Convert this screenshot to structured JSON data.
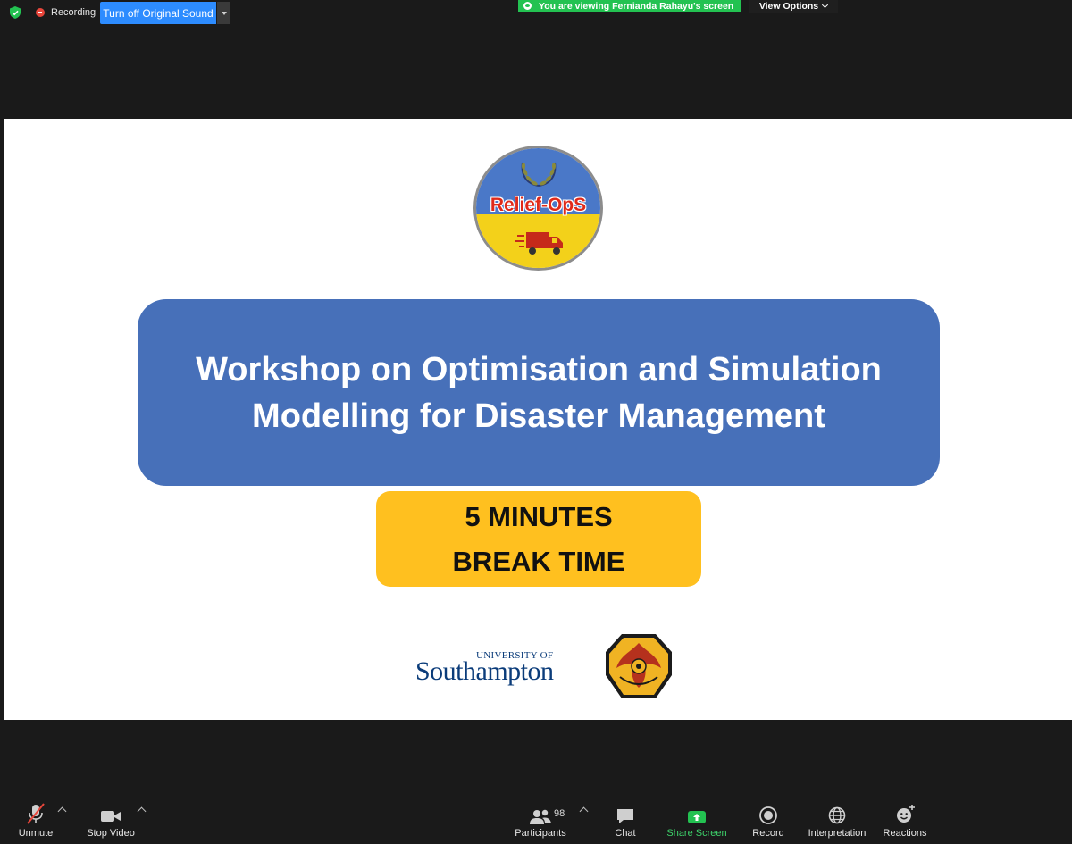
{
  "top_bar": {
    "recording_label": "Recording",
    "original_sound_button": "Turn off Original Sound",
    "viewing_banner": "You are viewing Fernianda Rahayu's screen",
    "view_options": "View Options"
  },
  "slide": {
    "logo_text": "Relief-OpS",
    "title_lines": [
      "Workshop on Optimisation and Simulation",
      "Modelling for Disaster Management"
    ],
    "break_lines": [
      "5 MINUTES",
      "BREAK TIME"
    ],
    "university_small": "UNIVERSITY OF",
    "university_big": "Southampton"
  },
  "toolbar": {
    "unmute": "Unmute",
    "stop_video": "Stop Video",
    "participants": "Participants",
    "participants_count": "98",
    "chat": "Chat",
    "share_screen": "Share Screen",
    "record": "Record",
    "interpretation": "Interpretation",
    "reactions": "Reactions"
  },
  "colors": {
    "zoom_blue": "#2d8cff",
    "viewing_green": "#23c251",
    "title_box": "#4770b9",
    "break_box": "#ffc01f",
    "share_green": "#23c251",
    "mute_red": "#e8463b"
  }
}
